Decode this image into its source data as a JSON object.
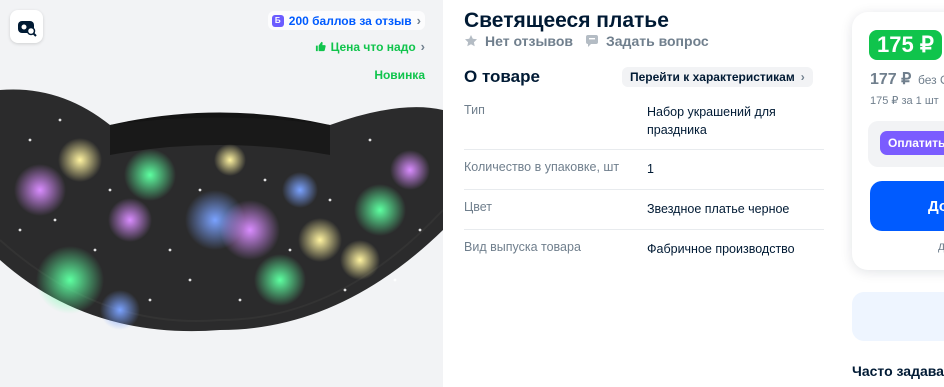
{
  "gallery": {
    "badges": {
      "points": "200 баллов за отзыв",
      "good_price": "Цена что надо",
      "new": "Новинка"
    },
    "image_alt": "Светящееся платье"
  },
  "product": {
    "title": "Светящееся платье",
    "reviews": "Нет отзывов",
    "ask": "Задать вопрос"
  },
  "about": {
    "heading": "О товаре",
    "link": "Перейти к характеристикам",
    "specs": [
      {
        "key": "Тип",
        "value": "Набор украшений для праздника"
      },
      {
        "key": "Количество в упаковке, шт",
        "value": "1"
      },
      {
        "key": "Цвет",
        "value": "Звездное платье черное"
      },
      {
        "key": "Вид выпуска товара",
        "value": "Фабричное производство"
      }
    ]
  },
  "buy": {
    "price": "175 ₽",
    "old_price": "177 ₽",
    "old_note": "без О",
    "unit_price": "175 ₽ за 1 шт",
    "pay_label": "Оплатить",
    "add_label": "До",
    "add_note": "д"
  },
  "faq": {
    "heading": "Часто задава"
  },
  "colors": {
    "accent": "#005bff",
    "green": "#10c44c",
    "pay_purple": "#7b5cff",
    "muted": "#707f8d"
  },
  "icons": [
    "image-search-icon",
    "points-coin-icon",
    "thumb-up-icon",
    "chevron-right-icon",
    "star-icon",
    "chat-icon"
  ]
}
